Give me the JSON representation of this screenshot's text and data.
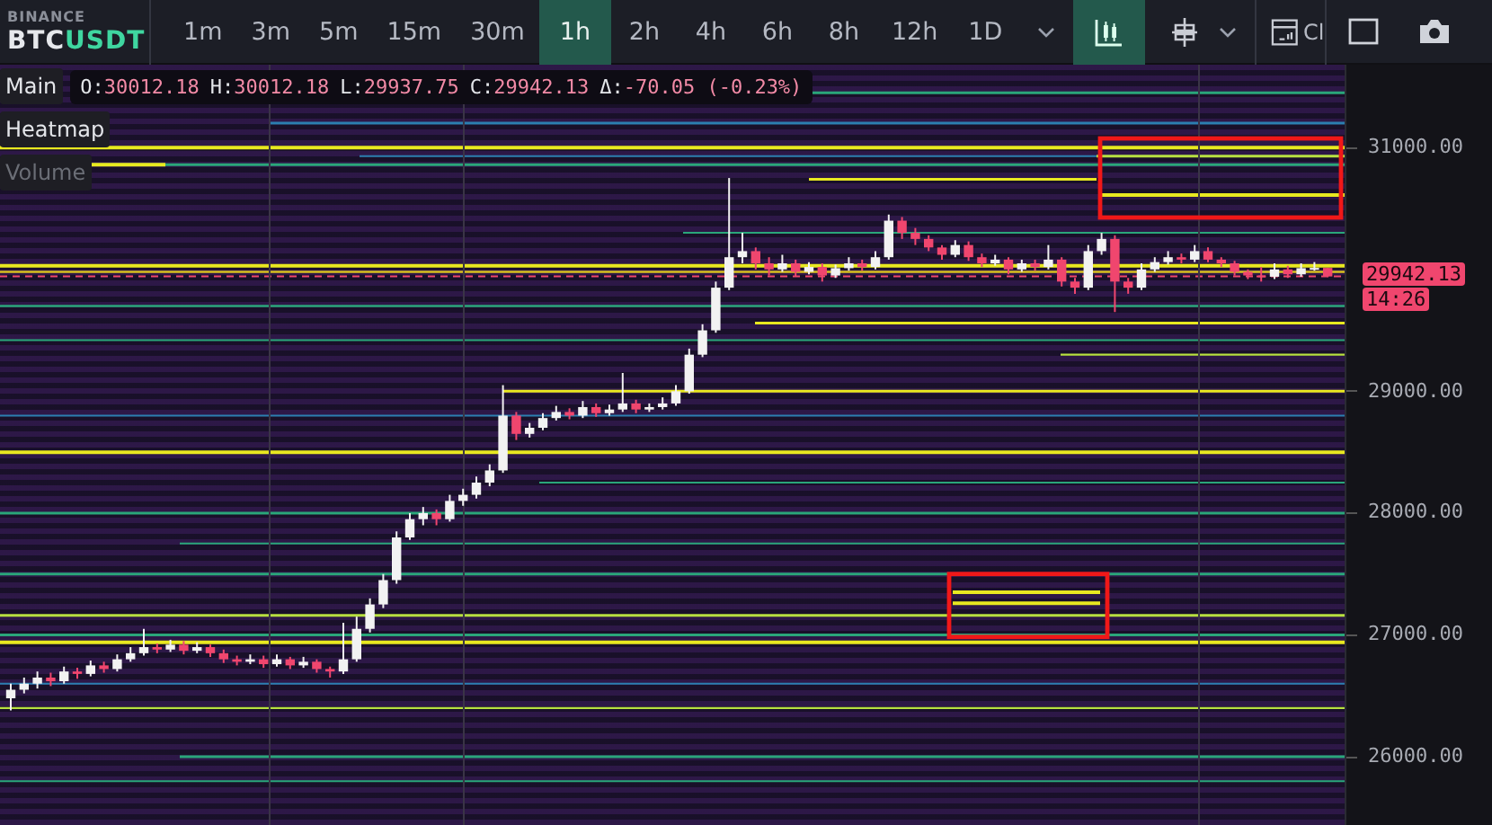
{
  "exchange": "BINANCE",
  "symbol": {
    "base": "BTC",
    "quote": "USDT"
  },
  "intervals": [
    {
      "label": "1m",
      "selected": false
    },
    {
      "label": "3m",
      "selected": false
    },
    {
      "label": "5m",
      "selected": false
    },
    {
      "label": "15m",
      "selected": false
    },
    {
      "label": "30m",
      "selected": false
    },
    {
      "label": "1h",
      "selected": true
    },
    {
      "label": "2h",
      "selected": false
    },
    {
      "label": "4h",
      "selected": false
    },
    {
      "label": "6h",
      "selected": false
    },
    {
      "label": "8h",
      "selected": false
    },
    {
      "label": "12h",
      "selected": false
    },
    {
      "label": "1D",
      "selected": false
    }
  ],
  "chart_type_selected": true,
  "indicators_cut_label": "Cl",
  "legend": {
    "pane": "Main",
    "values": [
      {
        "key": "O:",
        "value": "30012.18"
      },
      {
        "key": "H:",
        "value": "30012.18"
      },
      {
        "key": "L:",
        "value": "29937.75"
      },
      {
        "key": "C:",
        "value": "29942.13"
      },
      {
        "key": "Δ:",
        "value": "-70.05 (-0.23%)"
      }
    ],
    "layers": [
      {
        "label": "Heatmap",
        "visible": true
      },
      {
        "label": "Volume",
        "visible": false
      }
    ]
  },
  "chart_data": {
    "type": "candlestick",
    "grid": true,
    "ylim": [
      25440,
      31680
    ],
    "yticks": [
      {
        "value": 31000,
        "label": "31000.00"
      },
      {
        "value": 29000,
        "label": "29000.00"
      },
      {
        "value": 28000,
        "label": "28000.00"
      },
      {
        "value": 27000,
        "label": "27000.00"
      },
      {
        "value": 26000,
        "label": "26000.00"
      }
    ],
    "ohlc": [
      [
        26480,
        26600,
        26380,
        26550
      ],
      [
        26550,
        26650,
        26520,
        26600
      ],
      [
        26600,
        26700,
        26560,
        26650
      ],
      [
        26650,
        26690,
        26580,
        26620
      ],
      [
        26620,
        26740,
        26600,
        26700
      ],
      [
        26700,
        26730,
        26640,
        26680
      ],
      [
        26680,
        26790,
        26660,
        26750
      ],
      [
        26750,
        26780,
        26690,
        26720
      ],
      [
        26720,
        26840,
        26700,
        26800
      ],
      [
        26800,
        26900,
        26780,
        26850
      ],
      [
        26850,
        27050,
        26830,
        26900
      ],
      [
        26900,
        26930,
        26850,
        26880
      ],
      [
        26880,
        26960,
        26860,
        26920
      ],
      [
        26920,
        26950,
        26840,
        26870
      ],
      [
        26870,
        26940,
        26850,
        26900
      ],
      [
        26900,
        26920,
        26820,
        26850
      ],
      [
        26850,
        26880,
        26770,
        26800
      ],
      [
        26800,
        26830,
        26750,
        26780
      ],
      [
        26780,
        26840,
        26760,
        26800
      ],
      [
        26800,
        26830,
        26730,
        26760
      ],
      [
        26760,
        26840,
        26740,
        26800
      ],
      [
        26800,
        26820,
        26720,
        26750
      ],
      [
        26750,
        26820,
        26730,
        26780
      ],
      [
        26780,
        26800,
        26690,
        26720
      ],
      [
        26720,
        26740,
        26650,
        26700
      ],
      [
        26700,
        27100,
        26680,
        26800
      ],
      [
        26800,
        27150,
        26780,
        27050
      ],
      [
        27050,
        27300,
        27020,
        27250
      ],
      [
        27250,
        27500,
        27220,
        27450
      ],
      [
        27450,
        27850,
        27420,
        27800
      ],
      [
        27800,
        28000,
        27780,
        27950
      ],
      [
        27950,
        28050,
        27900,
        28000
      ],
      [
        28000,
        28030,
        27900,
        27950
      ],
      [
        27950,
        28150,
        27930,
        28100
      ],
      [
        28100,
        28200,
        28060,
        28150
      ],
      [
        28150,
        28300,
        28120,
        28250
      ],
      [
        28250,
        28400,
        28220,
        28350
      ],
      [
        28350,
        29050,
        28330,
        28800
      ],
      [
        28800,
        28830,
        28600,
        28650
      ],
      [
        28650,
        28740,
        28620,
        28700
      ],
      [
        28700,
        28820,
        28680,
        28780
      ],
      [
        28780,
        28880,
        28760,
        28830
      ],
      [
        28830,
        28860,
        28770,
        28800
      ],
      [
        28800,
        28920,
        28780,
        28870
      ],
      [
        28870,
        28900,
        28790,
        28820
      ],
      [
        28820,
        28890,
        28800,
        28850
      ],
      [
        28850,
        29150,
        28830,
        28900
      ],
      [
        28900,
        28930,
        28820,
        28850
      ],
      [
        28850,
        28900,
        28830,
        28870
      ],
      [
        28870,
        28950,
        28850,
        28900
      ],
      [
        28900,
        29050,
        28880,
        29000
      ],
      [
        29000,
        29350,
        28980,
        29300
      ],
      [
        29300,
        29550,
        29280,
        29500
      ],
      [
        29500,
        29900,
        29480,
        29850
      ],
      [
        29850,
        30750,
        29830,
        30100
      ],
      [
        30100,
        30300,
        30050,
        30150
      ],
      [
        30150,
        30180,
        30000,
        30050
      ],
      [
        30050,
        30100,
        29950,
        30000
      ],
      [
        30000,
        30120,
        29980,
        30050
      ],
      [
        30050,
        30080,
        29940,
        29980
      ],
      [
        29980,
        30060,
        29960,
        30020
      ],
      [
        30020,
        30050,
        29900,
        29950
      ],
      [
        29950,
        30040,
        29930,
        30010
      ],
      [
        30010,
        30100,
        29990,
        30050
      ],
      [
        30050,
        30080,
        29990,
        30020
      ],
      [
        30020,
        30150,
        30000,
        30100
      ],
      [
        30100,
        30450,
        30080,
        30400
      ],
      [
        30400,
        30430,
        30250,
        30300
      ],
      [
        30300,
        30340,
        30200,
        30250
      ],
      [
        30250,
        30280,
        30150,
        30180
      ],
      [
        30180,
        30200,
        30080,
        30120
      ],
      [
        30120,
        30240,
        30100,
        30200
      ],
      [
        30200,
        30230,
        30070,
        30100
      ],
      [
        30100,
        30130,
        30020,
        30050
      ],
      [
        30050,
        30120,
        30030,
        30080
      ],
      [
        30080,
        30100,
        29960,
        30000
      ],
      [
        30000,
        30080,
        29980,
        30050
      ],
      [
        30050,
        30080,
        29990,
        30020
      ],
      [
        30020,
        30200,
        30000,
        30080
      ],
      [
        30080,
        30100,
        29860,
        29900
      ],
      [
        29900,
        29930,
        29800,
        29850
      ],
      [
        29850,
        30200,
        29830,
        30150
      ],
      [
        30150,
        30300,
        30120,
        30250
      ],
      [
        30250,
        30280,
        29650,
        29900
      ],
      [
        29900,
        29930,
        29800,
        29850
      ],
      [
        29850,
        30050,
        29830,
        30000
      ],
      [
        30000,
        30100,
        29980,
        30060
      ],
      [
        30060,
        30150,
        30040,
        30100
      ],
      [
        30100,
        30130,
        30050,
        30080
      ],
      [
        30080,
        30200,
        30060,
        30150
      ],
      [
        30150,
        30180,
        30060,
        30080
      ],
      [
        30080,
        30100,
        30020,
        30050
      ],
      [
        30050,
        30070,
        29950,
        29980
      ],
      [
        29980,
        30000,
        29920,
        29950
      ],
      [
        29950,
        30020,
        29900,
        29940
      ],
      [
        29940,
        30050,
        29920,
        30000
      ],
      [
        30000,
        30030,
        29930,
        29960
      ],
      [
        29960,
        30050,
        29940,
        30010
      ],
      [
        30010,
        30060,
        29990,
        30012.18
      ],
      [
        30012.18,
        30012.18,
        29937.75,
        29942.13
      ]
    ]
  },
  "last_price": {
    "price": "29942.13",
    "countdown": "14:26"
  }
}
